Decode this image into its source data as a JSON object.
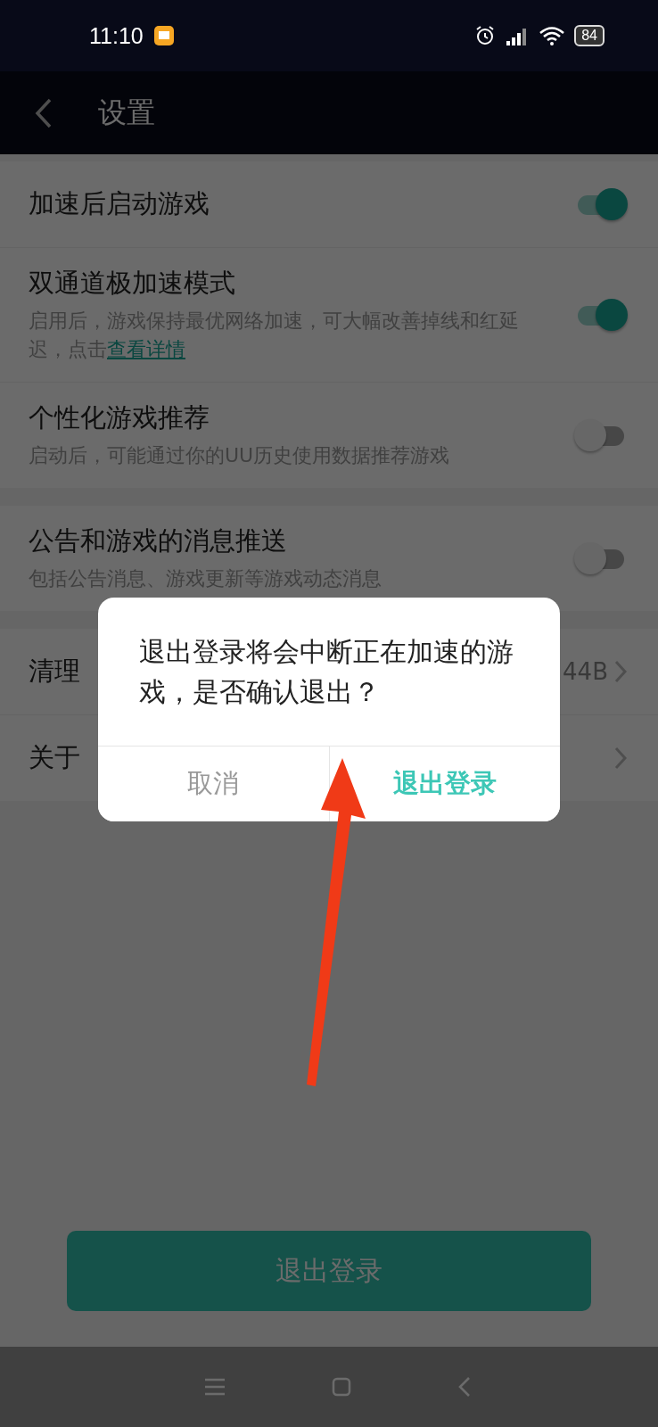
{
  "status_bar": {
    "time": "11:10",
    "battery": "84"
  },
  "header": {
    "title": "设置"
  },
  "groups": [
    {
      "items": [
        {
          "kind": "toggle",
          "title": "加速后启动游戏",
          "on": true
        },
        {
          "kind": "toggle",
          "title": "双通道极加速模式",
          "description": "启用后，游戏保持最优网络加速，可大幅改善掉线和红延迟，点击",
          "link": "查看详情",
          "on": true
        },
        {
          "kind": "toggle",
          "title": "个性化游戏推荐",
          "description": "启动后，可能通过你的UU历史使用数据推荐游戏",
          "on": false
        }
      ]
    },
    {
      "items": [
        {
          "kind": "toggle",
          "title": "公告和游戏的消息推送",
          "description": "包括公告消息、游戏更新等游戏动态消息",
          "on": false
        }
      ]
    },
    {
      "items": [
        {
          "kind": "nav",
          "title": "清理",
          "value": "44B"
        },
        {
          "kind": "nav",
          "title": "关于"
        }
      ]
    }
  ],
  "logout_button": {
    "label": "退出登录"
  },
  "dialog": {
    "message": "退出登录将会中断正在加速的游戏，是否确认退出？",
    "buttons": [
      {
        "kind": "cancel",
        "label": "取消"
      },
      {
        "kind": "confirm",
        "label": "退出登录"
      }
    ]
  }
}
